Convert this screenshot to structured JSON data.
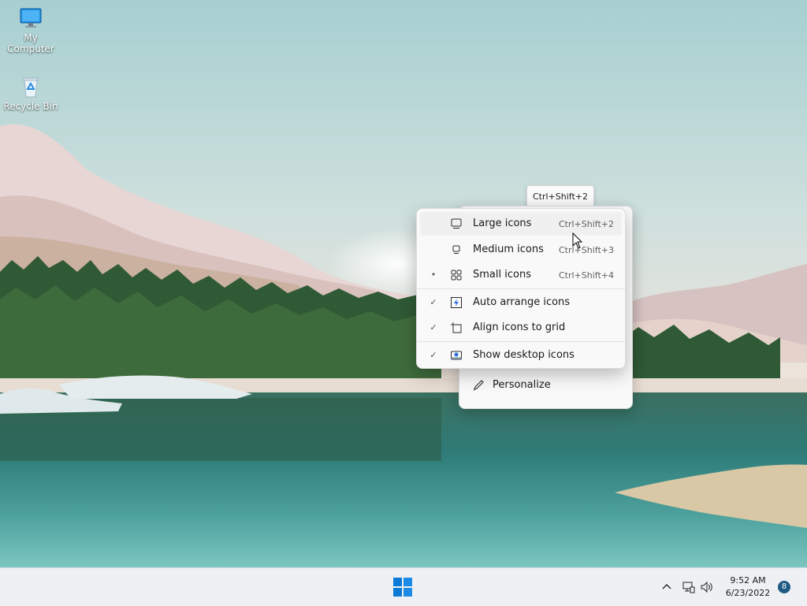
{
  "desktop": {
    "icons": [
      {
        "label": "My Computer",
        "icon": "monitor-icon"
      },
      {
        "label": "Recycle Bin",
        "icon": "recycle-bin-icon"
      }
    ]
  },
  "tooltip": {
    "text": "Ctrl+Shift+2"
  },
  "view_submenu": {
    "items": [
      {
        "label": "Large icons",
        "shortcut": "Ctrl+Shift+2",
        "icon": "large-icons-icon",
        "marker": ""
      },
      {
        "label": "Medium icons",
        "shortcut": "Ctrl+Shift+3",
        "icon": "medium-icons-icon",
        "marker": ""
      },
      {
        "label": "Small icons",
        "shortcut": "Ctrl+Shift+4",
        "icon": "small-icons-icon",
        "marker": "•"
      },
      {
        "label": "Auto arrange icons",
        "icon": "auto-arrange-icon",
        "marker": "✓"
      },
      {
        "label": "Align icons to grid",
        "icon": "align-grid-icon",
        "marker": "✓"
      },
      {
        "label": "Show desktop icons",
        "icon": "show-desktop-icon",
        "marker": "✓"
      }
    ]
  },
  "main_menu": {
    "personalize": {
      "label": "Personalize",
      "icon": "pen-icon"
    }
  },
  "taskbar": {
    "start_icon": "windows-start-icon",
    "tray_icons": [
      "chevron-up-icon",
      "network-icon",
      "volume-icon"
    ],
    "time": "9:52 AM",
    "date": "6/23/2022",
    "notifications": "8"
  },
  "colors": {
    "accent": "#0067c0",
    "menu_bg": "#f9f9f9",
    "taskbar_bg": "#eef0f3",
    "badge": "#1e5a83"
  }
}
